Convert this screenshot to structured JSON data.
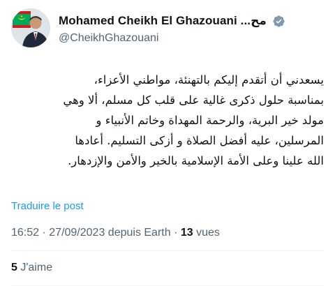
{
  "author": {
    "display_name": "Mohamed Cheikh El Ghazouani ...مح",
    "handle": "@CheikhGhazouani",
    "verified_icon": "verified-badge-icon",
    "flag_colors": {
      "green": "#00a95c",
      "yellow": "#ffd700",
      "red": "#d01c1f"
    }
  },
  "tweet": {
    "lines": [
      "يسعدني أن أتقدم إليكم بالتهنئة، مواطني الأعزاء،",
      "بمناسبة حلول ذكرى غالية على قلب كل مسلم، ألا وهي",
      "مولد خير البرية، والرحمة المهداة وخاتم الأنبياء و",
      "المرسلين، عليه أفضل الصلاة و أزكى التسليم. أعادها",
      "الله علينا وعلى الأمة الإسلامية بالخير والأمن والإزدهار."
    ]
  },
  "translate_label": "Traduire le post",
  "meta": {
    "time": "16:52",
    "sep1": " · ",
    "date": "27/09/2023",
    "source": " depuis Earth",
    "sep2": " · ",
    "views_count": "13",
    "views_label": " vues"
  },
  "likes": {
    "count": "5",
    "label": " J'aime"
  },
  "colors": {
    "accent": "#1d9bf0",
    "secondary_text": "#536471",
    "primary_text": "#0f1419"
  }
}
